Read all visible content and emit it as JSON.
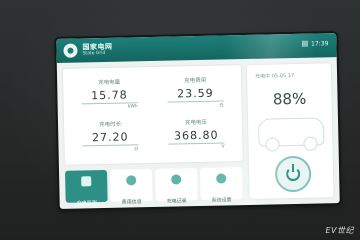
{
  "header": {
    "brand_cn": "国家电网",
    "brand_en": "State Grid",
    "time": "17:39"
  },
  "stats": [
    {
      "label": "充电电量",
      "value": "15.78",
      "unit": "kWh"
    },
    {
      "label": "充电费用",
      "value": "23.59",
      "unit": "元"
    },
    {
      "label": "充电时长",
      "value": "27.20",
      "unit": "分"
    },
    {
      "label": "充电电压",
      "value": "368.80",
      "unit": "V"
    }
  ],
  "status_panel": {
    "header": "充电中 05-05 17",
    "soc": "88%"
  },
  "nav": [
    {
      "label": "充电监测"
    },
    {
      "label": "费用信息"
    },
    {
      "label": "充电记录"
    },
    {
      "label": "系统设置"
    }
  ],
  "watermark": "EV世纪"
}
